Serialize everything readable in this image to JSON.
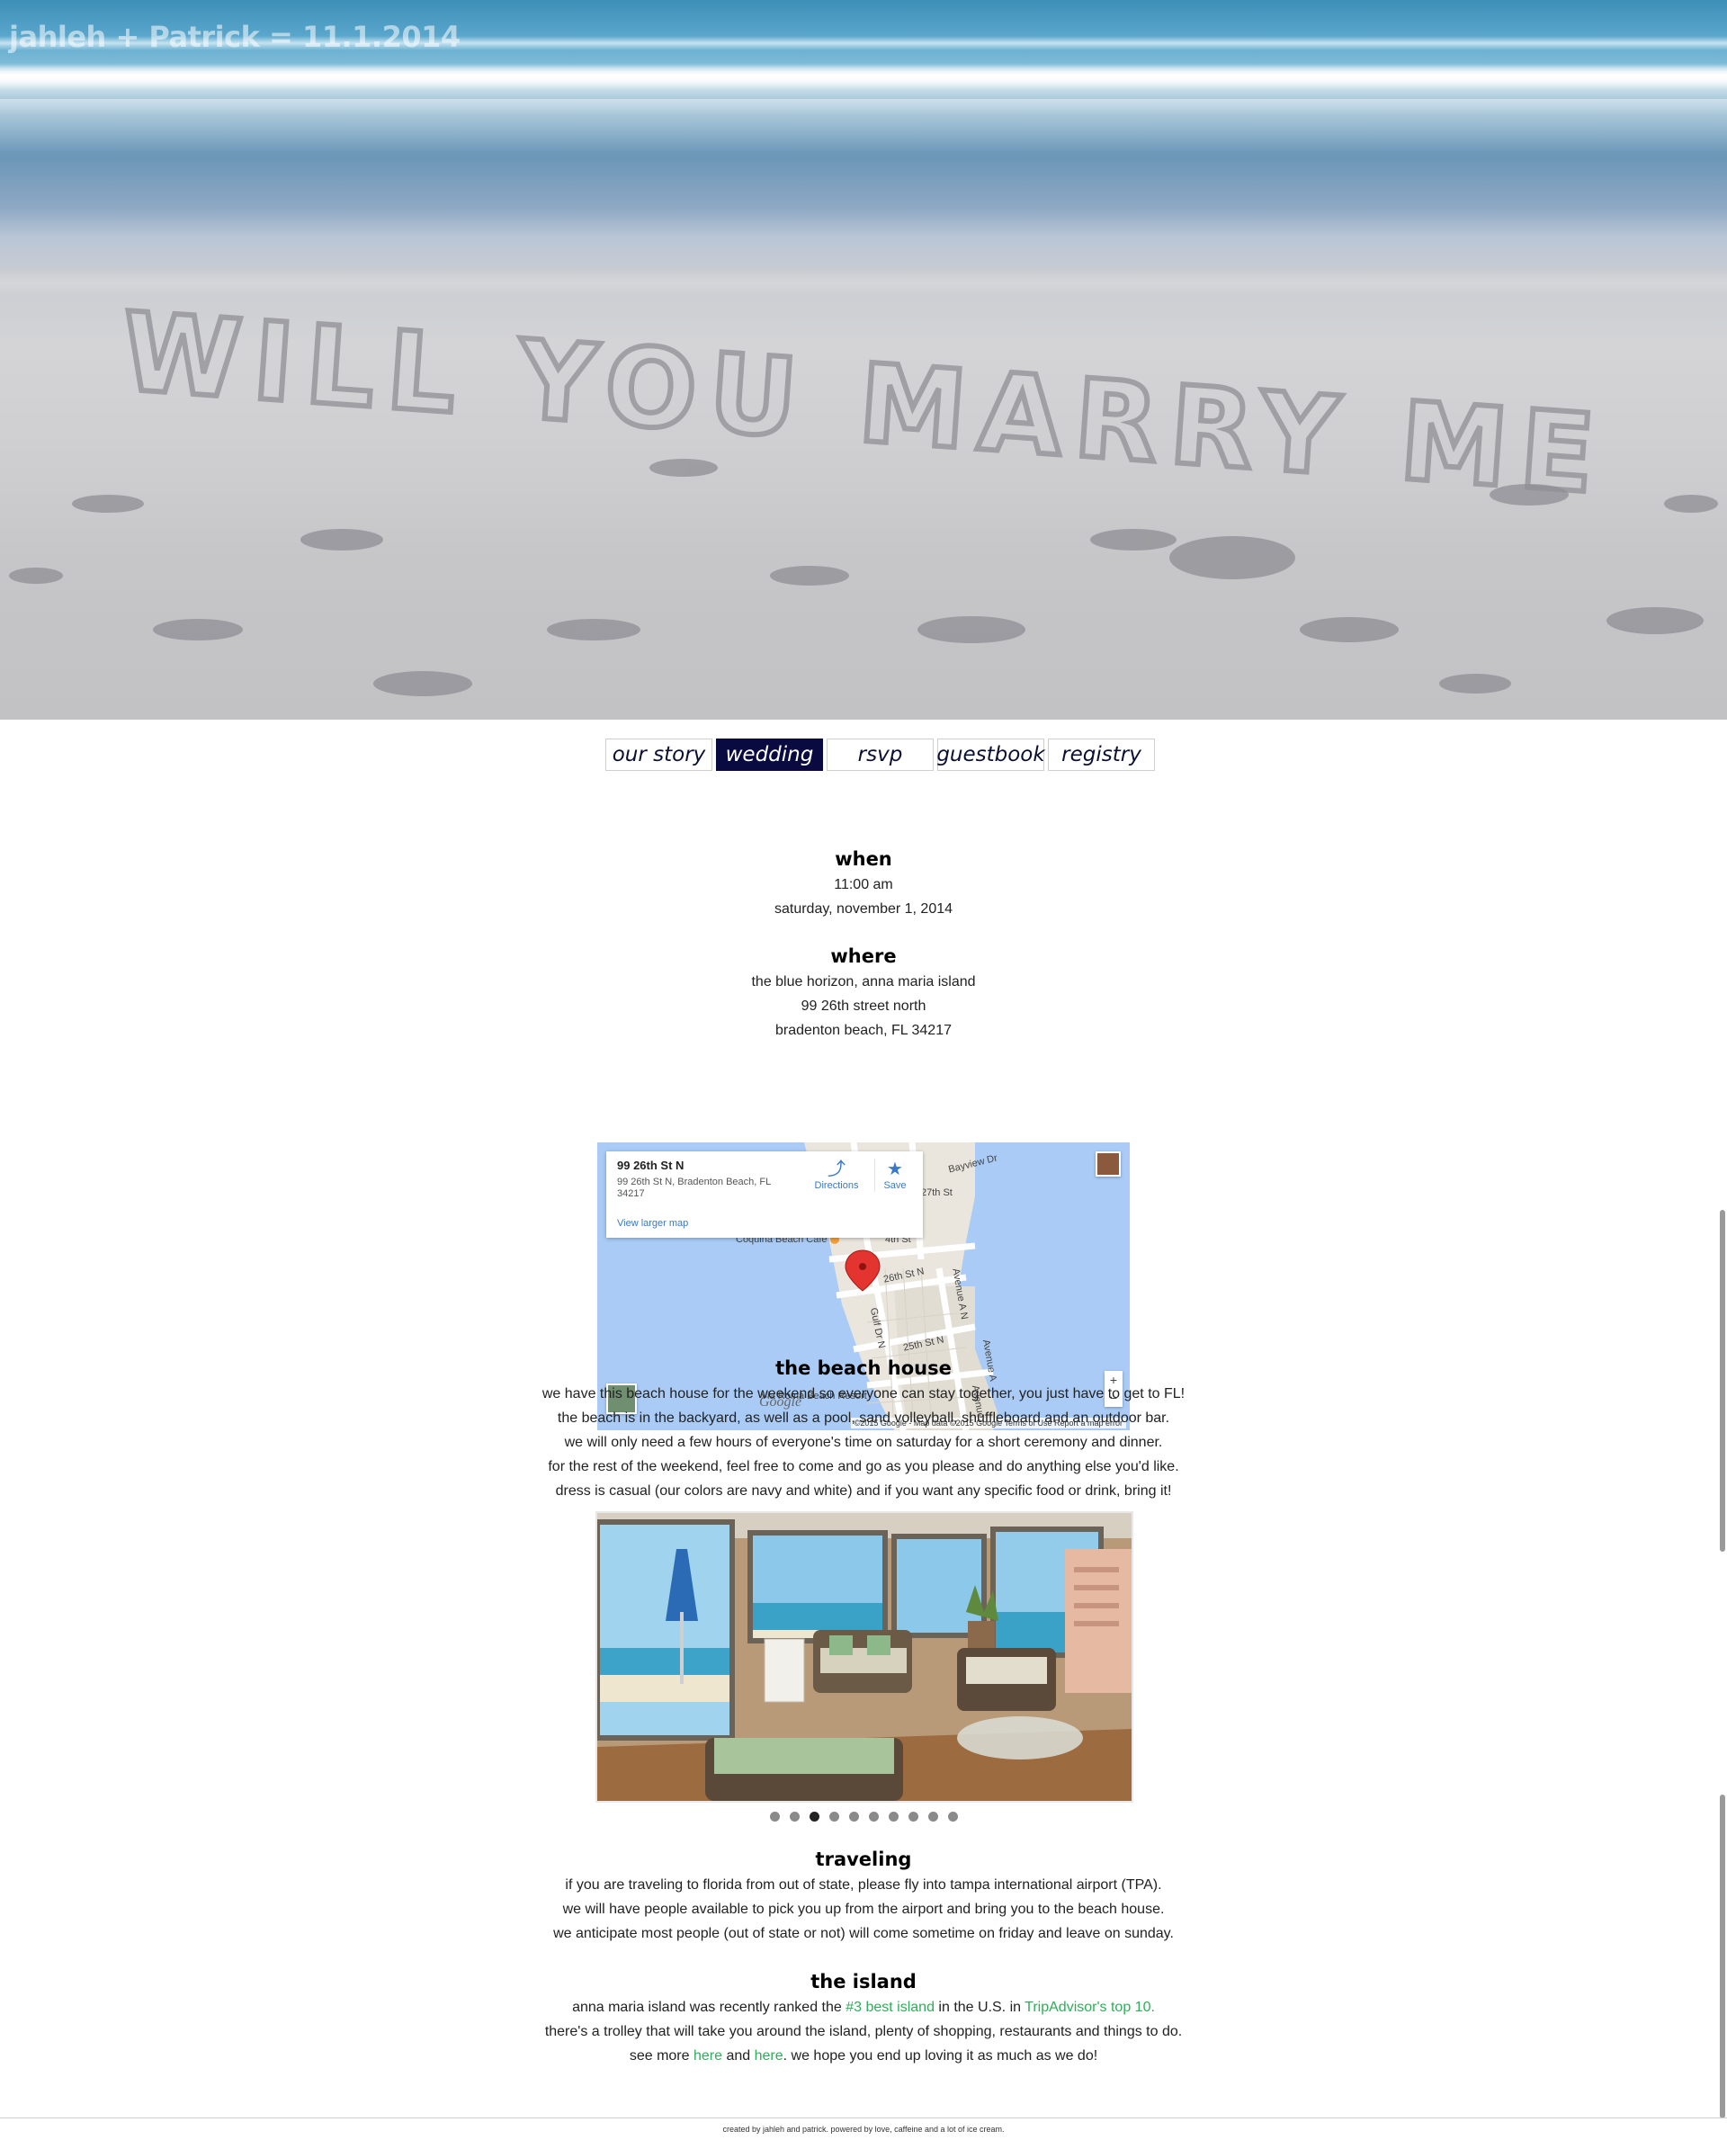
{
  "hero": {
    "title": "jahleh + Patrick = 11.1.2014",
    "sand_writing": "WILL YOU MARRY ME"
  },
  "nav": {
    "tabs": [
      {
        "label": "our story",
        "active": false
      },
      {
        "label": "wedding",
        "active": true
      },
      {
        "label": "rsvp",
        "active": false
      },
      {
        "label": "guestbook",
        "active": false
      },
      {
        "label": "registry",
        "active": false
      }
    ]
  },
  "when": {
    "heading": "when",
    "time": "11:00 am",
    "date": "saturday, november 1, 2014"
  },
  "where": {
    "heading": "where",
    "venue": "the blue horizon, anna maria island",
    "street": "99 26th street north",
    "city": "bradenton beach, FL 34217"
  },
  "map": {
    "place_name": "99 26th St N",
    "place_address": "99 26th St N, Bradenton Beach, FL 34217",
    "view_larger": "View larger map",
    "directions": "Directions",
    "save": "Save",
    "labels": {
      "bayview": "Bayview Dr",
      "st27": "27th St",
      "st27b": "4th St",
      "coquina": "Coquina Beach Cafe",
      "st26": "26th St N",
      "st25": "25th St N",
      "gulf": "Gulf Dr N",
      "avenue_an": "Avenue A N",
      "avenue_a": "Avenue A",
      "avenue_b": "Avenue",
      "via_roma": "Via Roma Beach Resort"
    },
    "logo": "Google",
    "attribution": "©2015 Google - Map data ©2015 Google   Terms of Use   Report a map error",
    "zoom_in": "+",
    "zoom_out": "−",
    "accent_color": "#3a78c8",
    "water_color": "#a9cbf5"
  },
  "beach_house": {
    "heading": "the beach house",
    "lines": [
      "we have this beach house for the weekend so everyone can stay together, you just have to get to FL!",
      "the beach is in the backyard, as well as a pool, sand volleyball, shuffleboard and an outdoor bar.",
      "we will only need a few hours of everyone's time on saturday for a short ceremony and dinner.",
      "for the rest of the weekend, feel free to come and go as you please and do anything else you'd like.",
      "dress is casual (our colors are navy and white) and if you want any specific food or drink, bring it!"
    ],
    "slider": {
      "count": 10,
      "active_index": 2
    }
  },
  "traveling": {
    "heading": "traveling",
    "lines": [
      "if you are traveling to florida from out of state, please fly into tampa international airport (TPA).",
      "we will have people available to pick you up from the airport and bring you to the beach house.",
      "we anticipate most people (out of state or not) will come sometime on friday and leave on sunday."
    ]
  },
  "island": {
    "heading": "the island",
    "line1_pre": "anna maria island was recently ranked the ",
    "line1_link1": "#3 best island",
    "line1_mid": " in the U.S. in ",
    "line1_link2": "TripAdvisor's top 10.",
    "line2": "there's a trolley that will take you around the island, plenty of shopping, restaurants and things to do.",
    "line3_pre": "see more ",
    "line3_link1": "here",
    "line3_mid": " and ",
    "line3_link2": "here",
    "line3_post": ". we hope you end up loving it as much as we do!"
  },
  "footer": {
    "text": "created by jahleh and patrick. powered by love, caffeine and a lot of ice cream."
  },
  "colors": {
    "nav_active_bg": "#090a40",
    "link": "#2fae59"
  }
}
